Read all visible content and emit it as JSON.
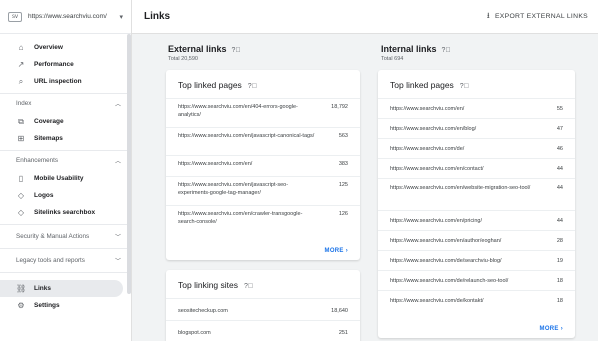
{
  "property": {
    "url": "https://www.searchviu.com/"
  },
  "sidebar": {
    "top_items": [
      {
        "label": "Overview"
      },
      {
        "label": "Performance"
      },
      {
        "label": "URL inspection"
      }
    ],
    "index": {
      "label": "Index",
      "items": [
        {
          "label": "Coverage"
        },
        {
          "label": "Sitemaps"
        }
      ]
    },
    "enhancements": {
      "label": "Enhancements",
      "items": [
        {
          "label": "Mobile Usability"
        },
        {
          "label": "Logos"
        },
        {
          "label": "Sitelinks searchbox"
        }
      ]
    },
    "security": {
      "label": "Security & Manual Actions"
    },
    "legacy": {
      "label": "Legacy tools and reports"
    },
    "bottom_items": [
      {
        "label": "Links"
      },
      {
        "label": "Settings"
      }
    ]
  },
  "header": {
    "title": "Links",
    "export_label": "EXPORT EXTERNAL LINKS"
  },
  "external": {
    "title": "External links",
    "total": "Total 20,590",
    "top_linked": {
      "title": "Top linked pages",
      "rows": [
        {
          "url": "https://www.searchviu.com/en/404-errors-google-analytics/",
          "count": "18,792"
        },
        {
          "url": "https://www.searchviu.com/en/javascript-canonical-tags/",
          "count": "563"
        },
        {
          "url": "https://www.searchviu.com/en/",
          "count": "383"
        },
        {
          "url": "https://www.searchviu.com/en/javascript-seo-experiments-google-tag-manager/",
          "count": "125"
        },
        {
          "url": "https://www.searchviu.com/en/crawler-transgoogle-search-console/",
          "count": "126"
        }
      ],
      "more": "MORE"
    },
    "top_sites": {
      "title": "Top linking sites",
      "rows": [
        {
          "url": "seositecheckup.com",
          "count": "18,640"
        },
        {
          "url": "blogspot.com",
          "count": "251"
        }
      ]
    }
  },
  "internal": {
    "title": "Internal links",
    "total": "Total 694",
    "top_linked": {
      "title": "Top linked pages",
      "rows": [
        {
          "url": "https://www.searchviu.com/en/",
          "count": "55"
        },
        {
          "url": "https://www.searchviu.com/en/blog/",
          "count": "47"
        },
        {
          "url": "https://www.searchviu.com/de/",
          "count": "46"
        },
        {
          "url": "https://www.searchviu.com/en/contact/",
          "count": "44"
        },
        {
          "url": "https://www.searchviu.com/en/website-migration-seo-tool/",
          "count": "44"
        },
        {
          "url": "https://www.searchviu.com/en/pricing/",
          "count": "44"
        },
        {
          "url": "https://www.searchviu.com/en/author/eoghan/",
          "count": "28"
        },
        {
          "url": "https://www.searchviu.com/de/searchviu-blog/",
          "count": "19"
        },
        {
          "url": "https://www.searchviu.com/de/relaunch-seo-tool/",
          "count": "18"
        },
        {
          "url": "https://www.searchviu.com/de/kontakt/",
          "count": "18"
        }
      ],
      "more": "MORE"
    }
  }
}
